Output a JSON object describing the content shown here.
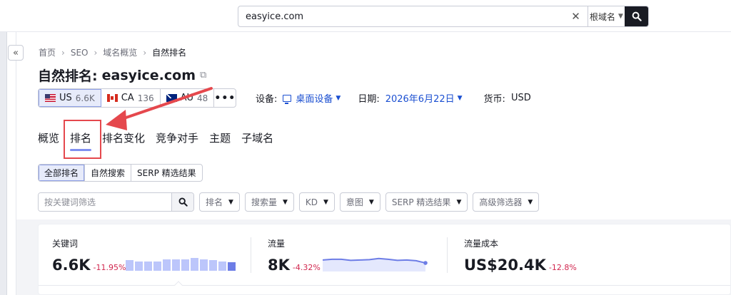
{
  "search": {
    "value": "easyice.com",
    "scope_label": "根域名"
  },
  "breadcrumb": {
    "items": [
      "首页",
      "SEO",
      "域名概览"
    ],
    "current": "自然排名"
  },
  "title": {
    "prefix": "自然排名:",
    "domain": "easyice.com"
  },
  "databases": [
    {
      "code": "US",
      "count": "6.6K",
      "flag": "us"
    },
    {
      "code": "CA",
      "count": "136",
      "flag": "ca"
    },
    {
      "code": "AU",
      "count": "48",
      "flag": "au"
    }
  ],
  "more_label": "•••",
  "settings": {
    "device_label": "设备:",
    "device_value": "桌面设备",
    "date_label": "日期:",
    "date_value": "2026年6月22日",
    "currency_label": "货币:",
    "currency_value": "USD"
  },
  "tabs": [
    "概览",
    "排名",
    "排名变化",
    "竞争对手",
    "主题",
    "子域名"
  ],
  "active_tab": "排名",
  "subtabs": [
    "全部排名",
    "自然搜索",
    "SERP 精选结果"
  ],
  "filters": {
    "search_placeholder": "按关键词筛选",
    "buttons": [
      "排名",
      "搜索量",
      "KD",
      "意图",
      "SERP 精选结果",
      "高级筛选器"
    ]
  },
  "metrics": [
    {
      "label": "关键词",
      "value": "6.6K",
      "delta": "-11.95%",
      "trend": [
        0.68,
        0.6,
        0.6,
        0.6,
        0.72,
        0.72,
        0.72,
        0.8,
        0.72,
        0.68,
        0.6,
        0.56
      ]
    },
    {
      "label": "流量",
      "value": "8K",
      "delta": "-4.32%",
      "trend": [
        0.62,
        0.66,
        0.66,
        0.6,
        0.62,
        0.64,
        0.7,
        0.66,
        0.6,
        0.62,
        0.58,
        0.46
      ]
    },
    {
      "label": "流量成本",
      "value": "US$20.4K",
      "delta": "-12.8%"
    }
  ],
  "colors": {
    "accent": "#1b4fd1",
    "negative": "#d1264e",
    "highlight": "#e5484d",
    "bar": "#bcc6fb",
    "bar_last": "#6d7de6"
  }
}
